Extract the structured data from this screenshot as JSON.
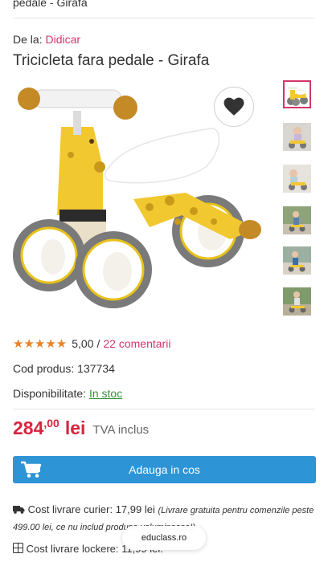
{
  "breadcrumb": {
    "tail": "pedale - Girafa"
  },
  "seller": {
    "prefix": "De la:",
    "name": "Didicar"
  },
  "product": {
    "title": "Tricicleta fara pedale - Girafa",
    "rating_value": "5,00",
    "rating_separator": "/",
    "reviews_link": "22 comentarii",
    "rating_stars": 5,
    "code_label": "Cod produs:",
    "code_value": "137734",
    "availability_label": "Disponibilitate:",
    "availability_value": "In stoc"
  },
  "price": {
    "integer": "284",
    "decimals": ",00",
    "currency": "lei",
    "vat_note": "TVA inclus"
  },
  "cart": {
    "button_label": "Adauga in cos"
  },
  "shipping": {
    "courier_label": "Cost livrare curier: 17,99 lei",
    "courier_note": "(Livrare gratuita pentru comenzile peste 499.00 lei, ce nu includ produse voluminoase!)",
    "locker_label": "Cost livrare lockere: 11,99 lei."
  },
  "browser": {
    "url": "educlass.ro"
  },
  "colors": {
    "accent": "#d6336c",
    "price": "#d6253f",
    "button": "#2d94d6",
    "stars": "#e8832a",
    "in_stock": "#3a8f3a"
  },
  "icons": [
    "heart-icon",
    "star-icon",
    "cart-icon",
    "truck-icon",
    "locker-icon"
  ]
}
